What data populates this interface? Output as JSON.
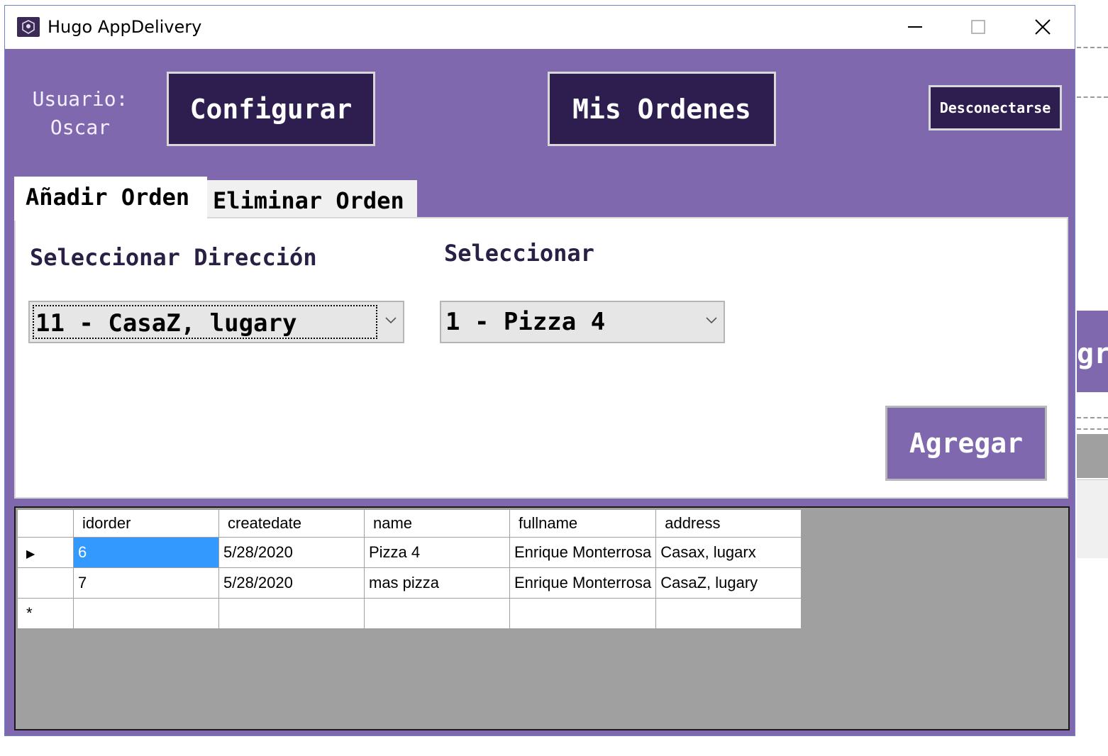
{
  "window": {
    "title": "Hugo AppDelivery",
    "controls": {
      "minimize": "minimize-icon",
      "maximize": "maximize-icon",
      "close": "close-icon"
    }
  },
  "header": {
    "user_label": "Usuario:",
    "user_name": "Oscar",
    "configure_label": "Configurar",
    "orders_label": "Mis Ordenes",
    "logout_label": "Desconectarse"
  },
  "tabs": [
    {
      "label": "Añadir Orden",
      "active": true
    },
    {
      "label": "Eliminar Orden",
      "active": false
    }
  ],
  "add_order": {
    "address_label": "Seleccionar Dirección",
    "address_value": "11 - CasaZ, lugary",
    "product_label": "Seleccionar",
    "product_value": "1 - Pizza 4",
    "add_button": "Agregar"
  },
  "orders_grid": {
    "columns": [
      "idorder",
      "createdate",
      "name",
      "fullname",
      "address"
    ],
    "rows": [
      [
        "6",
        "5/28/2020",
        "Pizza 4",
        "Enrique Monterrosa",
        "Casax, lugarx"
      ],
      [
        "7",
        "5/28/2020",
        "mas pizza",
        "Enrique Monterrosa",
        "CasaZ, lugary"
      ]
    ],
    "current_row_marker": "▶",
    "new_row_marker": "*"
  },
  "background_app": {
    "partial_text": "gr"
  },
  "colors": {
    "accent": "#7f68ae",
    "dark_button": "#2e1e50",
    "selection": "#3399ff",
    "grid_background": "#a0a0a0"
  }
}
